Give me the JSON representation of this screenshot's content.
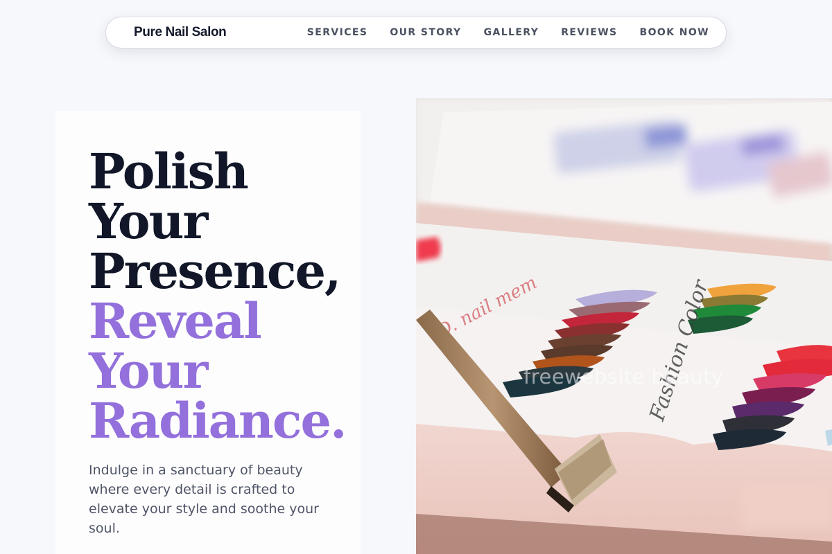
{
  "nav": {
    "brand": "Pure Nail Salon",
    "links": [
      "SERVICES",
      "OUR STORY",
      "GALLERY",
      "REVIEWS",
      "BOOK NOW"
    ]
  },
  "hero": {
    "headline_dark": [
      "Polish",
      "Your",
      "Presence,"
    ],
    "headline_accent": [
      "Reveal",
      "Your",
      "Radiance."
    ],
    "subtext": "Indulge in a sanctuary of beauty where every detail is crafted to elevate your style and soothe your soul.",
    "accent_color": "#9370db",
    "dark_color": "#111728"
  },
  "image": {
    "watermark": "freewebsite beauty",
    "card_script": "Fashion Color"
  }
}
